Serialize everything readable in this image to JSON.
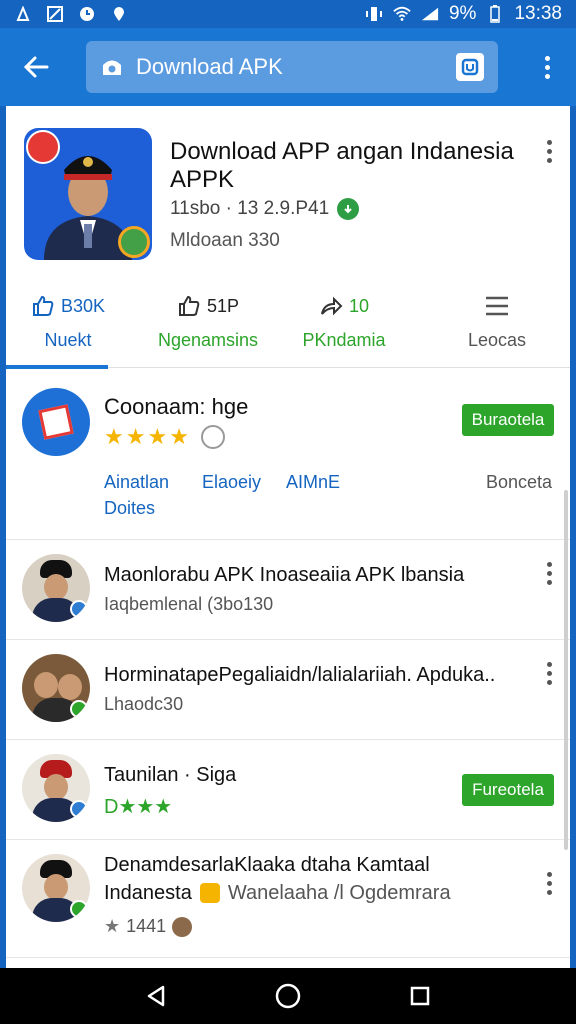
{
  "status_bar": {
    "battery": "9%",
    "time": "13:38"
  },
  "search": {
    "text": "Download APK"
  },
  "app": {
    "title": "Download APP angan Indanesia APPK",
    "meta": "11sbo · 13 2.9.P41",
    "downloads": "Mldoaan 330"
  },
  "actions": [
    {
      "count": "B30K",
      "label": "Nuekt",
      "color": "#1565c0"
    },
    {
      "count": "51P",
      "label": "Ngenamsins",
      "color": "#2ca52a"
    },
    {
      "count": "10",
      "label": "PKndamia",
      "color": "#2ca52a"
    },
    {
      "count": "",
      "label": "Leocas",
      "color": "#555555"
    }
  ],
  "featured": {
    "name": "Coonaam: hge",
    "rating_stars": 4,
    "install_label": "Buraotela",
    "links": [
      "Ainatlan",
      "Elaoeiy",
      "AIMnE",
      "Bonceta",
      "Doites"
    ]
  },
  "list": [
    {
      "title": "Maonlorabu APK Inoaseaiia APK lbansia",
      "subtitle": "Iaqbemlenal (3bo130",
      "action": "more"
    },
    {
      "title": "HorminatapePegaliaidn/lalialariiah. Apduka..",
      "subtitle": "Lhaodc30",
      "action": "more"
    },
    {
      "title": "Taunilan · Siga",
      "subtitle": "",
      "stars": "D★★★",
      "action": "install",
      "install_label": "Fureotela"
    },
    {
      "title": "DenamdesarlaKlaaka dtaha Kamtaal",
      "title2": "Indanesta",
      "title2b": "Wanelaaha /l Ogdemrara",
      "subtitle": "1441",
      "action": "more"
    }
  ],
  "colors": {
    "primary": "#1976d2",
    "install_green": "#2ca52a",
    "star": "#f5b400"
  }
}
